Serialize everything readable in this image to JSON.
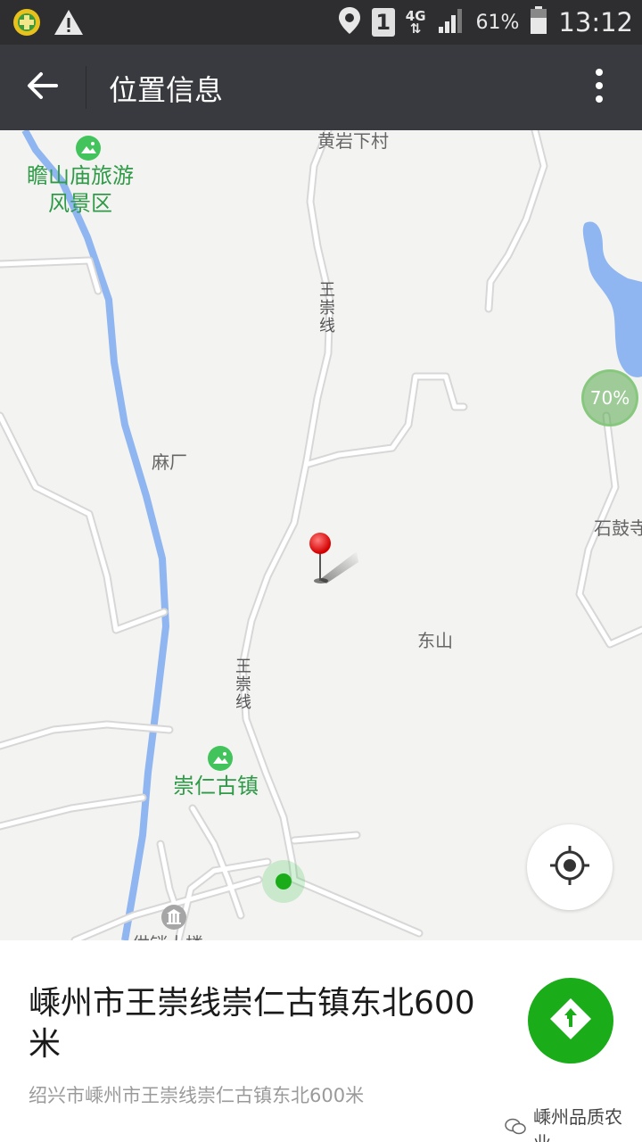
{
  "status_bar": {
    "battery": "61%",
    "time": "13:12",
    "network": "4G",
    "sim": "1"
  },
  "app_bar": {
    "title": "位置信息"
  },
  "map": {
    "labels": {
      "village_top": "黄岩下村",
      "scenic_area_line1": "瞻山庙旅游",
      "scenic_area_line2": "风景区",
      "road_upper": "王崇线",
      "road_lower": "王崇线",
      "mill": "麻厂",
      "east_hill": "东山",
      "temple": "石鼓寺",
      "ancient_town": "崇仁古镇",
      "bottom_place": "供销大楼"
    },
    "percent_badge": "70%",
    "icons": {
      "poi": "mountain-landscape-icon",
      "pin": "red-map-pin-icon",
      "locate": "crosshair-locate-icon",
      "bank": "building-icon"
    },
    "colors": {
      "river": "#8fb6f0",
      "lake": "#8fb6f0",
      "road": "#ffffff",
      "road_edge": "#d9d9d9",
      "poi_green": "#2f9a47"
    }
  },
  "location": {
    "title": "嵊州市王崇线崇仁古镇东北600米",
    "subtitle": "绍兴市嵊州市王崇线崇仁古镇东北600米",
    "nav_icon": "directions-arrow-icon",
    "accent": "#1aad19"
  },
  "watermark": {
    "text": "嵊州品质农业"
  }
}
